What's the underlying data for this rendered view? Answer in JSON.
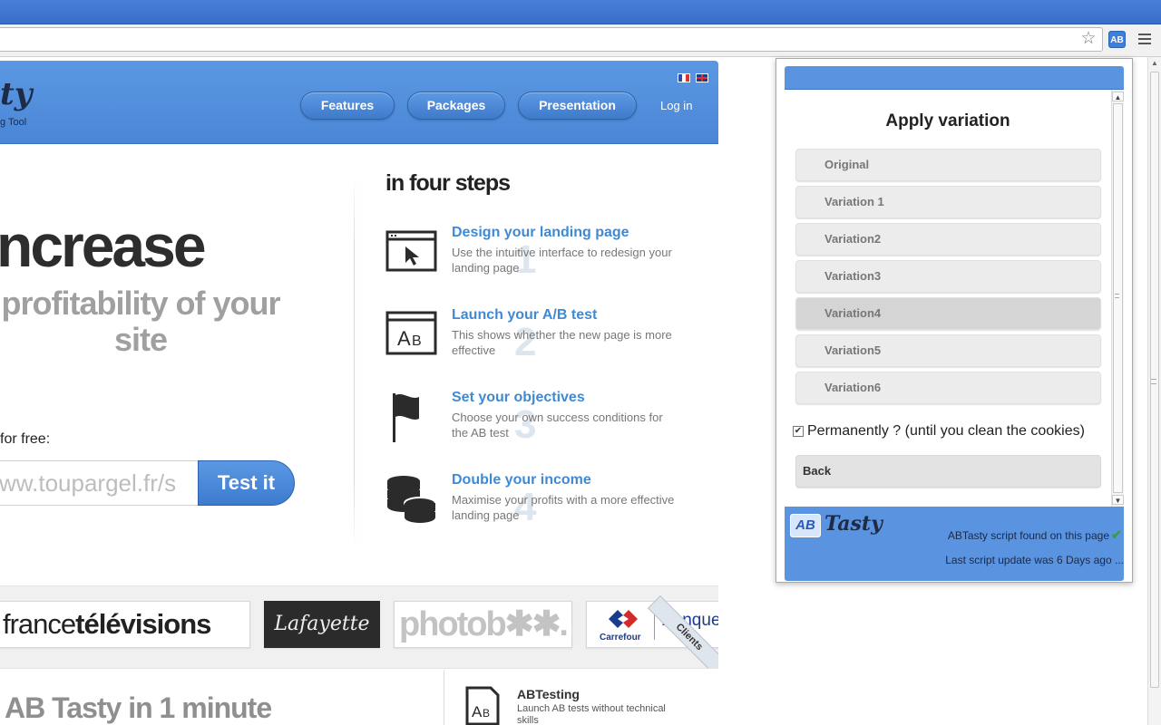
{
  "browser": {
    "star_icon": "star-icon",
    "ext_badge": "AB",
    "menu_icon": "menu-icon"
  },
  "site": {
    "logo": "ty",
    "logo_sub": "g Tool",
    "nav": [
      "Features",
      "Packages",
      "Presentation"
    ],
    "login": "Log in",
    "hero_main": "ncrease",
    "hero_sub": "profitability of your site",
    "try_label": "for free:",
    "url_value": "ww.toupargel.fr/s",
    "test_button": "Test it",
    "steps_title": "in four steps",
    "steps": [
      {
        "num": "1",
        "title": "Design your landing page",
        "desc": "Use the intuitive interface to redesign your landing page"
      },
      {
        "num": "2",
        "title": "Launch your A/B test",
        "desc": "This shows whether the new page is more effective"
      },
      {
        "num": "3",
        "title": "Set your objectives",
        "desc": "Choose your own success conditions for the AB test"
      },
      {
        "num": "4",
        "title": "Double your income",
        "desc": "Maximise your profits with a more effective landing page"
      }
    ],
    "clients": {
      "ribbon": "Clients",
      "ft_a": "france",
      "ft_b": "télévisions",
      "lafayette": "Lafayette",
      "photobox": "photob✱✱.",
      "carrefour": "Carrefour",
      "banque": "Banque"
    },
    "bottom_title": "AB Tasty in 1 minute",
    "feature_title": "ABTesting",
    "feature_desc": "Launch AB tests without technical skills"
  },
  "popup": {
    "title": "Apply variation",
    "variations": [
      "Original",
      "Variation 1",
      "Variation2",
      "Variation3",
      "Variation4",
      "Variation5",
      "Variation6"
    ],
    "active_index": 4,
    "permanent_checked": true,
    "permanent_label": "Permanently ? (until you clean the cookies)",
    "back": "Back",
    "footer_logo_box": "AB",
    "footer_logo_word": "Tasty",
    "status": "ABTasty script found on this page",
    "last_update": "Last script update was 6 Days ago ..."
  },
  "colors": {
    "brand_blue": "#5a93df",
    "link_blue": "#3f8ad4",
    "success_green": "#3b9c3b"
  }
}
